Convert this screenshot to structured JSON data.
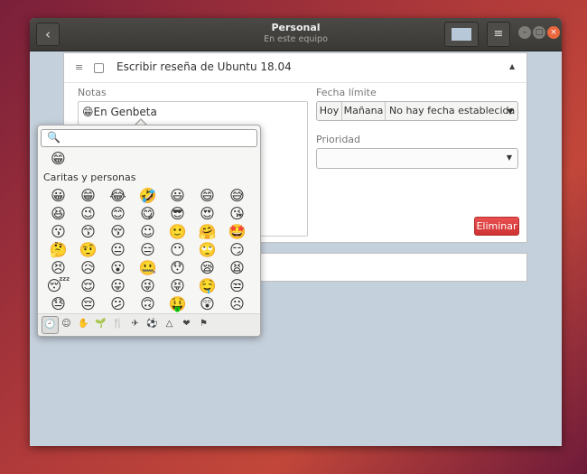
{
  "window": {
    "title": "Personal",
    "subtitle": "En este equipo",
    "back_glyph": "‹",
    "menu_glyph": "≡",
    "min_glyph": "–",
    "max_glyph": "□",
    "close_glyph": "×",
    "list_color": "#b7c8d8"
  },
  "task": {
    "title": "Escribir reseña de Ubuntu 18.04",
    "drag_glyph": "≡",
    "collapse_glyph": "▲",
    "notes_label": "Notas",
    "notes_value": "😁En Genbeta",
    "due_label": "Fecha límite",
    "today_label": "Hoy",
    "tomorrow_label": "Mañana",
    "due_value": "No hay fecha establecida",
    "priority_label": "Prioridad",
    "priority_value": "",
    "delete_label": "Eliminar",
    "delete_color": "#d93a3a"
  },
  "emoji_chooser": {
    "search_placeholder": "",
    "search_glyph": "🔍",
    "recent": [
      "😁"
    ],
    "category_title": "Caritas y personas",
    "emojis": [
      "😀",
      "😁",
      "😂",
      "🤣",
      "😃",
      "😄",
      "😅",
      "😆",
      "😉",
      "😊",
      "😋",
      "😎",
      "😍",
      "😘",
      "😗",
      "😙",
      "😚",
      "☺",
      "🙂",
      "🤗",
      "🤩",
      "🤔",
      "🤨",
      "😐",
      "😑",
      "😶",
      "🙄",
      "😏",
      "😣",
      "😥",
      "😮",
      "🤐",
      "😯",
      "😪",
      "😫",
      "😴",
      "😌",
      "😛",
      "😜",
      "😝",
      "🤤",
      "😒",
      "😓",
      "😔",
      "😕",
      "🙃",
      "🤑",
      "😲",
      "☹"
    ],
    "categories": [
      {
        "name": "recent",
        "glyph": "🕘"
      },
      {
        "name": "smileys",
        "glyph": "☺"
      },
      {
        "name": "body",
        "glyph": "✋"
      },
      {
        "name": "nature",
        "glyph": "🌱"
      },
      {
        "name": "food",
        "glyph": "🍴"
      },
      {
        "name": "travel",
        "glyph": "✈"
      },
      {
        "name": "activities",
        "glyph": "⚽"
      },
      {
        "name": "objects",
        "glyph": "△"
      },
      {
        "name": "symbols",
        "glyph": "❤"
      },
      {
        "name": "flags",
        "glyph": "⚑"
      }
    ]
  }
}
